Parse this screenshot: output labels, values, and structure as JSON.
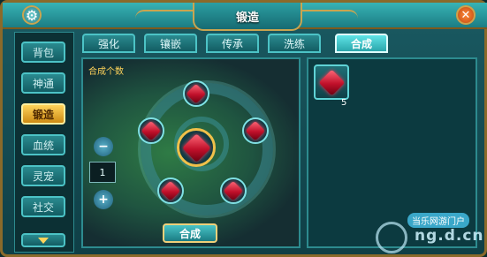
{
  "window": {
    "title": "锻造"
  },
  "sidebar": {
    "items": [
      {
        "label": "背包"
      },
      {
        "label": "神通"
      },
      {
        "label": "锻造"
      },
      {
        "label": "血统"
      },
      {
        "label": "灵宠"
      },
      {
        "label": "社交"
      }
    ],
    "active_index": 2
  },
  "tabs": [
    {
      "label": "强化"
    },
    {
      "label": "镶嵌"
    },
    {
      "label": "传承"
    },
    {
      "label": "洗练"
    },
    {
      "label": "合成"
    }
  ],
  "active_tab": 4,
  "main": {
    "count_label": "合成个数",
    "quantity": "1",
    "combine_button": "合成",
    "gem_slots": 6
  },
  "inventory": {
    "items": [
      {
        "icon": "red-gem-icon",
        "count": "5"
      }
    ]
  },
  "watermark": {
    "caption": "当乐网游门户",
    "text": "ng.d.cn"
  },
  "colors": {
    "accent": "#2aa6ab",
    "gold": "#f0c04a",
    "gem": "#c0102a"
  }
}
